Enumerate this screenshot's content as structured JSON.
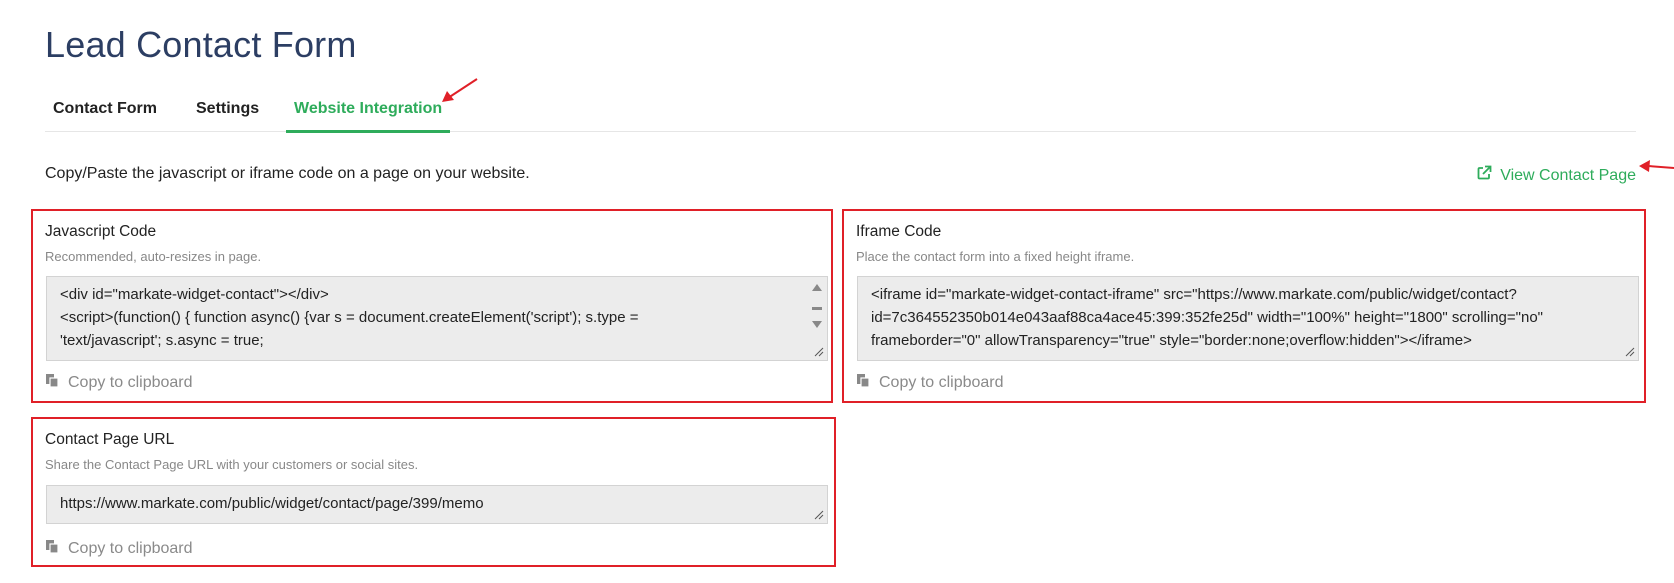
{
  "page": {
    "title": "Lead Contact Form"
  },
  "tabs": [
    {
      "label": "Contact Form",
      "active": false
    },
    {
      "label": "Settings",
      "active": false
    },
    {
      "label": "Website Integration",
      "active": true
    }
  ],
  "intro": "Copy/Paste the javascript or iframe code on a page on your website.",
  "view_link": {
    "label": "View Contact Page",
    "icon": "external-link-icon"
  },
  "javascript_panel": {
    "label": "Javascript Code",
    "hint": "Recommended, auto-resizes in page.",
    "code_lines": [
      "<div id=\"markate-widget-contact\"></div>",
      "<script>(function() { function async() {var s = document.createElement('script'); s.type =",
      "'text/javascript'; s.async = true;"
    ],
    "copy_label": "Copy to clipboard"
  },
  "iframe_panel": {
    "label": "Iframe Code",
    "hint": "Place the contact form into a fixed height iframe.",
    "code": "<iframe id=\"markate-widget-contact-iframe\" src=\"https://www.markate.com/public/widget/contact?id=7c364552350b014e043aaf88ca4ace45:399:352fe25d\" width=\"100%\" height=\"1800\" scrolling=\"no\" frameborder=\"0\" allowTransparency=\"true\" style=\"border:none;overflow:hidden\"></iframe>",
    "copy_label": "Copy to clipboard"
  },
  "url_panel": {
    "label": "Contact Page URL",
    "hint": "Share the Contact Page URL with your customers or social sites.",
    "url": "https://www.markate.com/public/widget/contact/page/399/memo",
    "copy_label": "Copy to clipboard"
  },
  "colors": {
    "accent": "#2eac5b",
    "title": "#2c3e63",
    "highlight": "#e02028"
  }
}
